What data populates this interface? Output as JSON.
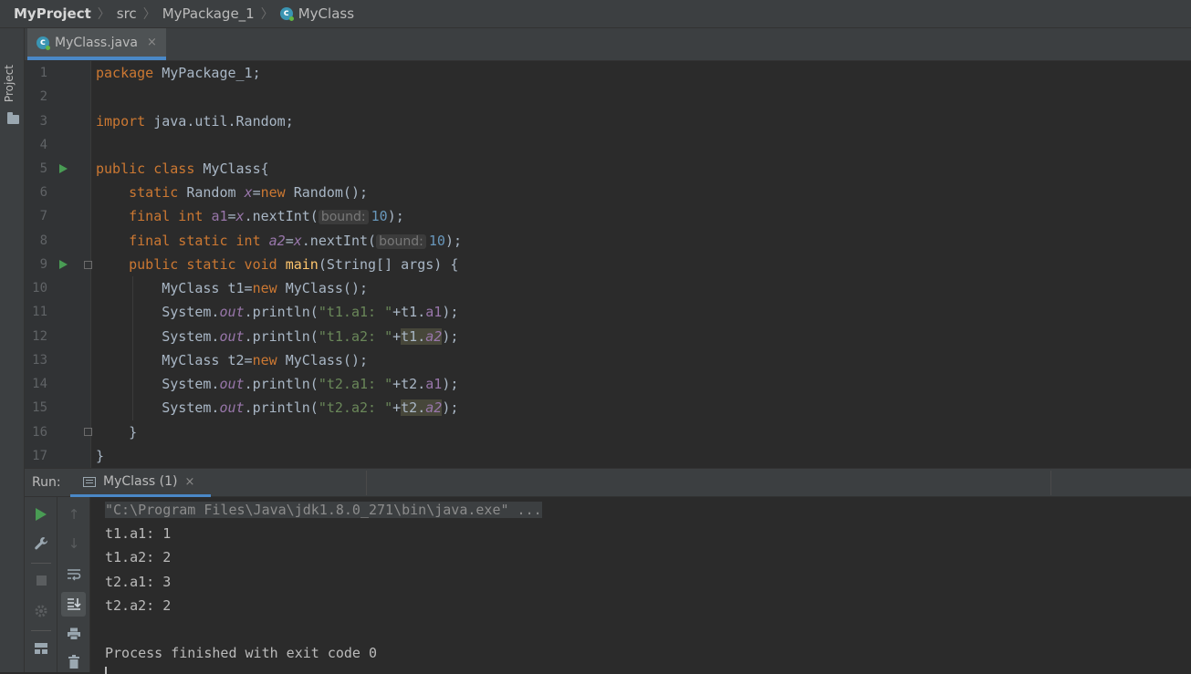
{
  "breadcrumb": {
    "project": "MyProject",
    "src": "src",
    "package": "MyPackage_1",
    "class": "MyClass"
  },
  "sidebar": {
    "project_label": "Project"
  },
  "editor_tab": {
    "label": "MyClass.java",
    "close": "×"
  },
  "gutter": {
    "line_numbers": [
      "1",
      "2",
      "3",
      "4",
      "5",
      "6",
      "7",
      "8",
      "9",
      "10",
      "11",
      "12",
      "13",
      "14",
      "15",
      "16",
      "17"
    ]
  },
  "code": {
    "l1_kw": "package",
    "l1_rest": " MyPackage_1;",
    "l3_kw": "import",
    "l3_rest": " java.util.Random;",
    "l5_kw": "public class",
    "l5_rest": " MyClass{",
    "l6_kw": "static",
    "l6_type": " Random ",
    "l6_var": "x",
    "l6_eq": "=",
    "l6_new": "new",
    "l6_rest": " Random();",
    "l7_kw": "final int",
    "l7_sp": " ",
    "l7_var": "a1",
    "l7_eq": "=",
    "l7_x": "x",
    "l7_call": ".nextInt(",
    "l7_hint": "bound:",
    "l7_num": "10",
    "l7_end": ");",
    "l8_kw": "final static int",
    "l8_sp": " ",
    "l8_var": "a2",
    "l8_eq": "=",
    "l8_x": "x",
    "l8_call": ".nextInt(",
    "l8_hint": "bound:",
    "l8_num": "10",
    "l8_end": ");",
    "l9_kw": "public static void",
    "l9_sp": " ",
    "l9_fn": "main",
    "l9_rest": "(String[] args) {",
    "l10_type": "MyClass t1=",
    "l10_new": "new",
    "l10_rest": " MyClass();",
    "l11_sys": "System.",
    "l11_out": "out",
    "l11_call": ".println(",
    "l11_str": "\"t1.a1: \"",
    "l11_plus": "+t1.",
    "l11_fld": "a1",
    "l11_end": ");",
    "l12_sys": "System.",
    "l12_out": "out",
    "l12_call": ".println(",
    "l12_str": "\"t1.a2: \"",
    "l12_plus": "+",
    "l12_obj": "t1.",
    "l12_fld": "a2",
    "l12_end": ");",
    "l13_type": "MyClass t2=",
    "l13_new": "new",
    "l13_rest": " MyClass();",
    "l14_sys": "System.",
    "l14_out": "out",
    "l14_call": ".println(",
    "l14_str": "\"t2.a1: \"",
    "l14_plus": "+t2.",
    "l14_fld": "a1",
    "l14_end": ");",
    "l15_sys": "System.",
    "l15_out": "out",
    "l15_call": ".println(",
    "l15_str": "\"t2.a2: \"",
    "l15_plus": "+",
    "l15_obj": "t2.",
    "l15_fld": "a2",
    "l15_end": ");",
    "l16": "}",
    "l17": "}"
  },
  "run_panel": {
    "label": "Run:",
    "tab_label": "MyClass (1)",
    "close": "×"
  },
  "console": {
    "command": "\"C:\\Program Files\\Java\\jdk1.8.0_271\\bin\\java.exe\" ...",
    "lines": [
      "t1.a1: 1",
      "t1.a2: 2",
      "t2.a1: 3",
      "t2.a2: 2"
    ],
    "exit": "Process finished with exit code 0"
  },
  "colors": {
    "keyword": "#cc7832",
    "field": "#9876aa",
    "string": "#6a8759",
    "number": "#6897bb",
    "function": "#ffc66d",
    "accent": "#4a88c7"
  }
}
